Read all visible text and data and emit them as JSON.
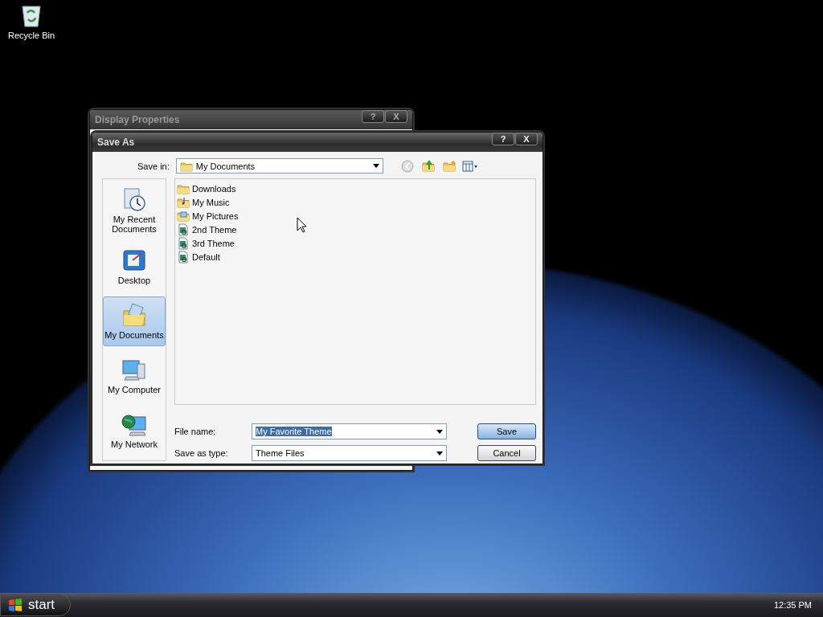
{
  "desktop": {
    "icons": [
      {
        "label": "Recycle Bin",
        "kind": "recycle-bin"
      }
    ]
  },
  "background_window": {
    "title": "Display Properties",
    "title_buttons": [
      "?",
      "X"
    ]
  },
  "dialog": {
    "title": "Save As",
    "title_buttons": [
      "?",
      "X"
    ],
    "save_in": {
      "label": "Save in:",
      "value": "My Documents"
    },
    "places": [
      {
        "label": "My Recent Documents",
        "kind": "recent",
        "selected": false
      },
      {
        "label": "Desktop",
        "kind": "desktop",
        "selected": false
      },
      {
        "label": "My Documents",
        "kind": "documents",
        "selected": true
      },
      {
        "label": "My Computer",
        "kind": "computer",
        "selected": false
      },
      {
        "label": "My Network",
        "kind": "network",
        "selected": false
      }
    ],
    "files": [
      {
        "name": "Downloads",
        "kind": "folder"
      },
      {
        "name": "My Music",
        "kind": "music-folder"
      },
      {
        "name": "My Pictures",
        "kind": "pictures-folder"
      },
      {
        "name": "2nd Theme",
        "kind": "theme"
      },
      {
        "name": "3rd Theme",
        "kind": "theme"
      },
      {
        "name": "Default",
        "kind": "theme"
      }
    ],
    "file_name": {
      "label": "File name:",
      "value": "My Favorite Theme",
      "value_selected": true
    },
    "save_type": {
      "label": "Save as type:",
      "value": "Theme Files"
    },
    "buttons": [
      {
        "label": "Save",
        "kind": "default"
      },
      {
        "label": "Cancel",
        "kind": "normal"
      }
    ]
  },
  "taskbar": {
    "start": "start",
    "clock": "12:35 PM"
  }
}
